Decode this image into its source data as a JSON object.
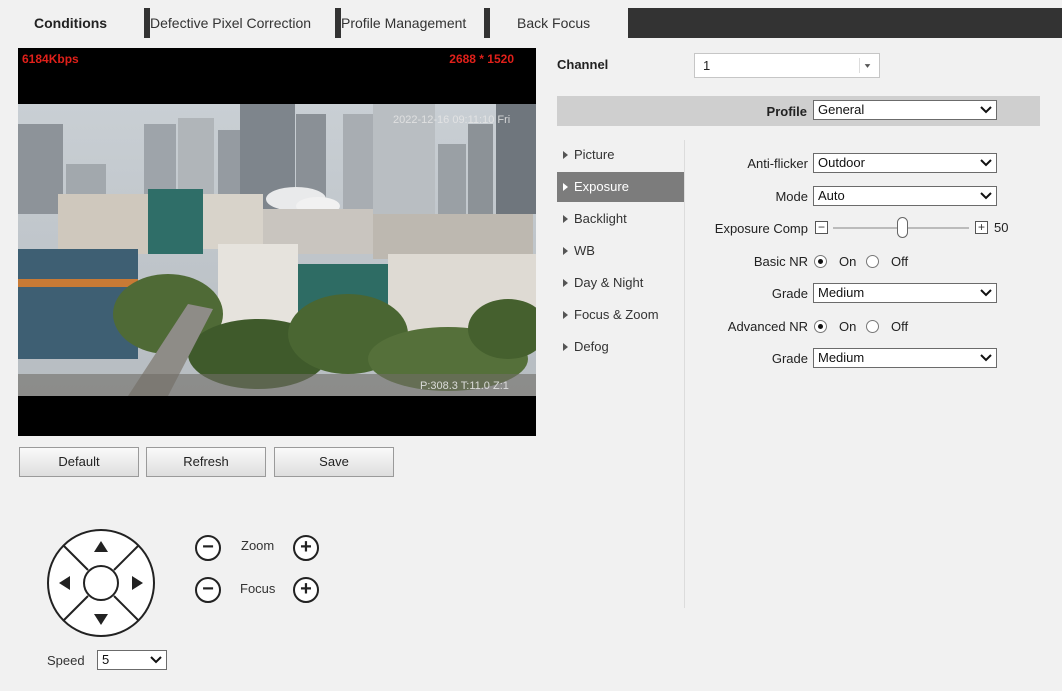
{
  "tabs": [
    {
      "label": "Conditions",
      "active": true
    },
    {
      "label": "Defective Pixel Correction",
      "active": false
    },
    {
      "label": "Profile Management",
      "active": false
    },
    {
      "label": "Back Focus",
      "active": false
    }
  ],
  "video": {
    "bitrate": "6184Kbps",
    "resolution": "2688 * 1520",
    "timestamp": "2022-12-16 09:11:10 Fri",
    "ptz_readout": "P:308.3 T:11.0 Z:1"
  },
  "buttons": {
    "default": "Default",
    "refresh": "Refresh",
    "save": "Save"
  },
  "ptz": {
    "zoom_label": "Zoom",
    "focus_label": "Focus",
    "speed_label": "Speed",
    "speed_value": "5",
    "minus_glyph": "−",
    "plus_glyph": "+"
  },
  "channel": {
    "label": "Channel",
    "value": "1"
  },
  "profile": {
    "label": "Profile",
    "value": "General"
  },
  "menu": [
    {
      "label": "Picture",
      "active": false
    },
    {
      "label": "Exposure",
      "active": true
    },
    {
      "label": "Backlight",
      "active": false
    },
    {
      "label": "WB",
      "active": false
    },
    {
      "label": "Day & Night",
      "active": false
    },
    {
      "label": "Focus & Zoom",
      "active": false
    },
    {
      "label": "Defog",
      "active": false
    }
  ],
  "exposure": {
    "anti_flicker": {
      "label": "Anti-flicker",
      "value": "Outdoor"
    },
    "mode": {
      "label": "Mode",
      "value": "Auto"
    },
    "exposure_comp": {
      "label": "Exposure Comp",
      "value": "50",
      "minus": "−",
      "plus": "+",
      "level": 0.5
    },
    "basic_nr": {
      "label": "Basic NR",
      "on": "On",
      "off": "Off",
      "selected": "On"
    },
    "grade1": {
      "label": "Grade",
      "value": "Medium"
    },
    "advanced_nr": {
      "label": "Advanced NR",
      "on": "On",
      "off": "Off",
      "selected": "On"
    },
    "grade2": {
      "label": "Grade",
      "value": "Medium"
    }
  },
  "colors": {
    "accent_dark": "#333333",
    "menu_active": "#7c7c7c",
    "osd_red": "#e0201a"
  }
}
